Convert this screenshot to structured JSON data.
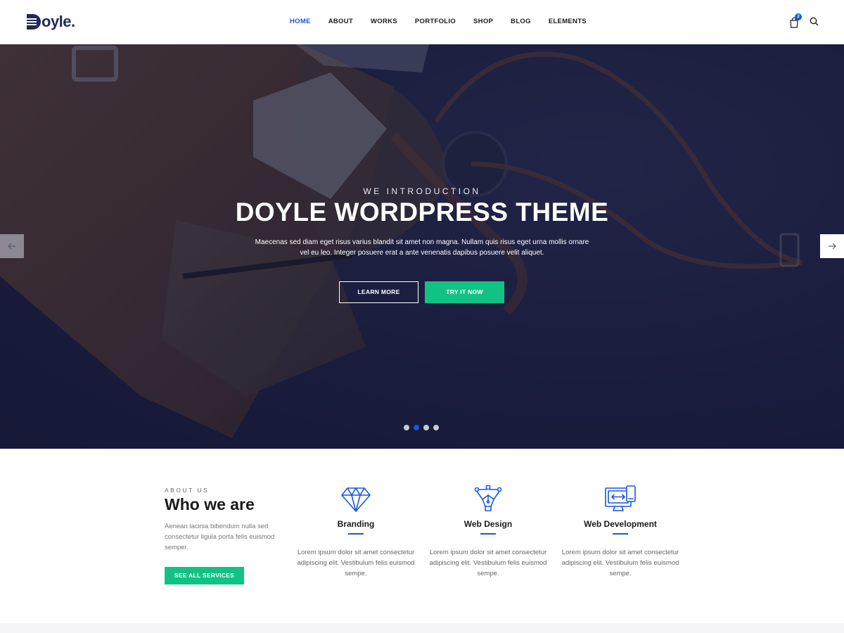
{
  "brand": {
    "logo_text": "oyle.",
    "accent": "#1a56db",
    "green": "#10c384",
    "dark": "#1e2a5a"
  },
  "nav": {
    "items": [
      {
        "label": "HOME",
        "active": true
      },
      {
        "label": "ABOUT",
        "active": false
      },
      {
        "label": "WORKS",
        "active": false
      },
      {
        "label": "PORTFOLIO",
        "active": false
      },
      {
        "label": "SHOP",
        "active": false
      },
      {
        "label": "BLOG",
        "active": false
      },
      {
        "label": "ELEMENTS",
        "active": false
      }
    ],
    "cart_count": "2",
    "cart_icon": "shopping-bag-icon",
    "search_icon": "search-icon"
  },
  "hero": {
    "kicker": "WE INTRODUCTION",
    "title": "DOYLE WORDPRESS THEME",
    "text": "Maecenas sed diam eget risus varius blandit sit amet non magna. Nullam quis risus eget urna mollis ornare vel eu leo. Integer posuere erat a ante venenatis dapibus posuere velit aliquet.",
    "primary_button": "LEARN MORE",
    "secondary_button": "TRY IT NOW",
    "slide_count": 4,
    "active_slide": 2
  },
  "about": {
    "kicker": "ABOUT US",
    "title": "Who we are",
    "text": "Aenean lacinia bibendum nulla sed consectetur ligula porta felis euismod semper.",
    "button": "SEE ALL SERVICES"
  },
  "services": [
    {
      "icon": "diamond-icon",
      "title": "Branding",
      "text": "Lorem ipsum dolor sit amet consectetur adipiscing elit. Vestibulum felis euismod sempe."
    },
    {
      "icon": "pen-tool-icon",
      "title": "Web Design",
      "text": "Lorem ipsum dolor sit amet consectetur adipiscing elit. Vestibulum felis euismod sempe."
    },
    {
      "icon": "monitor-icon",
      "title": "Web Development",
      "text": "Lorem ipsum dolor sit amet consectetur adipiscing elit. Vestibulum felis euismod sempe."
    }
  ]
}
